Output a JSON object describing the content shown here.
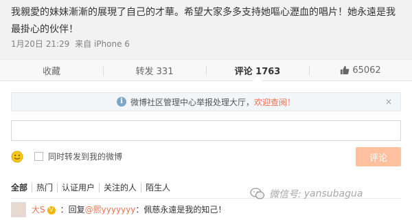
{
  "post": {
    "text": "我親愛的妹妹漸漸的展現了自己的才華。希望大家多多支持她嘔心瀝血的唱片！她永遠是我最掛心的伙伴！",
    "time": "1月20日 21:29",
    "source": "来自 iPhone 6"
  },
  "actions": {
    "favorite": "收藏",
    "repost": "转发 331",
    "comment": "评论 1763",
    "like": "65062"
  },
  "notice": {
    "text": "微博社区管理中心举报处理大厅，",
    "link": "欢迎查阅！",
    "close": "×"
  },
  "composer": {
    "input_value": "",
    "checkbox_label": "同时转发到我的微博",
    "submit": "评论"
  },
  "filters": [
    "全部",
    "热门",
    "认证用户",
    "关注的人",
    "陌生人"
  ],
  "comment": {
    "user": "大S",
    "badge": "V",
    "reply_prefix": "：回复",
    "mention": "@熙yyyyyyy",
    "body": "：佩慈永遠是我的知己！"
  },
  "watermark": {
    "label": "微信号:",
    "handle": "yansubagua"
  },
  "colors": {
    "accent": "#eb7350",
    "submit_bg": "#ffc09f",
    "notice_bg": "#f3f6f8"
  },
  "icons": {
    "notice": "info-icon",
    "like": "thumbs-up-icon",
    "composer": "smiley-icon",
    "watermark": "wechat-icon"
  }
}
